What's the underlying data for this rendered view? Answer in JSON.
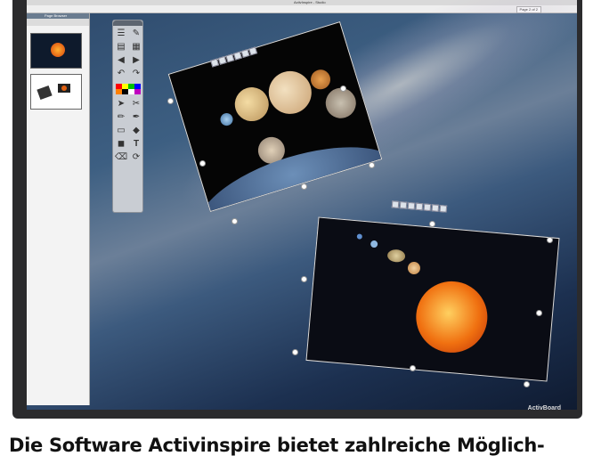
{
  "app": {
    "window_title": "ActivInspire - Studio",
    "page_indicator": "Page 2 of 2"
  },
  "page_browser": {
    "title": "Page Browser",
    "thumbnails": [
      {
        "label": "page-1"
      },
      {
        "label": "page-2"
      }
    ]
  },
  "toolbox": {
    "tools": [
      "main-menu-icon",
      "pen-icon",
      "page-icon",
      "browser-icon",
      "prev-page-icon",
      "next-page-icon",
      "undo-icon",
      "redo-icon",
      "select-icon",
      "wrench-icon",
      "pen-tool-icon",
      "highlighter-icon",
      "eraser-icon",
      "fill-icon",
      "shape-icon",
      "text-icon",
      "clear-icon",
      "reset-icon"
    ],
    "colors": [
      "#ff0000",
      "#ffff00",
      "#00c000",
      "#0000ff",
      "#ff8000",
      "#000000",
      "#ffffff",
      "#c000c0"
    ]
  },
  "brand": "ActivBoard",
  "caption": "Die Software Activinspire bietet zahlreiche Möglich-"
}
